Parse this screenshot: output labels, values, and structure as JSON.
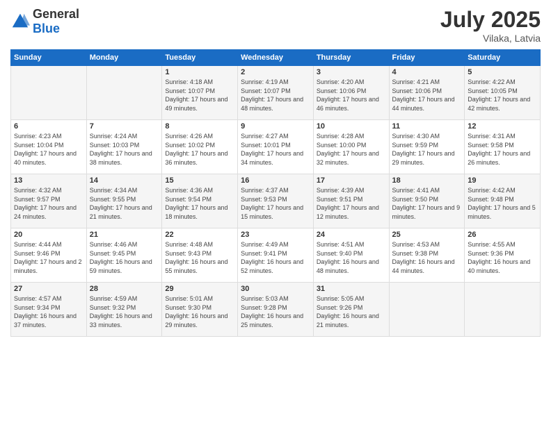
{
  "logo": {
    "general": "General",
    "blue": "Blue"
  },
  "header": {
    "month": "July 2025",
    "location": "Vilaka, Latvia"
  },
  "days_of_week": [
    "Sunday",
    "Monday",
    "Tuesday",
    "Wednesday",
    "Thursday",
    "Friday",
    "Saturday"
  ],
  "weeks": [
    [
      {
        "day": "",
        "info": ""
      },
      {
        "day": "",
        "info": ""
      },
      {
        "day": "1",
        "info": "Sunrise: 4:18 AM\nSunset: 10:07 PM\nDaylight: 17 hours and 49 minutes."
      },
      {
        "day": "2",
        "info": "Sunrise: 4:19 AM\nSunset: 10:07 PM\nDaylight: 17 hours and 48 minutes."
      },
      {
        "day": "3",
        "info": "Sunrise: 4:20 AM\nSunset: 10:06 PM\nDaylight: 17 hours and 46 minutes."
      },
      {
        "day": "4",
        "info": "Sunrise: 4:21 AM\nSunset: 10:06 PM\nDaylight: 17 hours and 44 minutes."
      },
      {
        "day": "5",
        "info": "Sunrise: 4:22 AM\nSunset: 10:05 PM\nDaylight: 17 hours and 42 minutes."
      }
    ],
    [
      {
        "day": "6",
        "info": "Sunrise: 4:23 AM\nSunset: 10:04 PM\nDaylight: 17 hours and 40 minutes."
      },
      {
        "day": "7",
        "info": "Sunrise: 4:24 AM\nSunset: 10:03 PM\nDaylight: 17 hours and 38 minutes."
      },
      {
        "day": "8",
        "info": "Sunrise: 4:26 AM\nSunset: 10:02 PM\nDaylight: 17 hours and 36 minutes."
      },
      {
        "day": "9",
        "info": "Sunrise: 4:27 AM\nSunset: 10:01 PM\nDaylight: 17 hours and 34 minutes."
      },
      {
        "day": "10",
        "info": "Sunrise: 4:28 AM\nSunset: 10:00 PM\nDaylight: 17 hours and 32 minutes."
      },
      {
        "day": "11",
        "info": "Sunrise: 4:30 AM\nSunset: 9:59 PM\nDaylight: 17 hours and 29 minutes."
      },
      {
        "day": "12",
        "info": "Sunrise: 4:31 AM\nSunset: 9:58 PM\nDaylight: 17 hours and 26 minutes."
      }
    ],
    [
      {
        "day": "13",
        "info": "Sunrise: 4:32 AM\nSunset: 9:57 PM\nDaylight: 17 hours and 24 minutes."
      },
      {
        "day": "14",
        "info": "Sunrise: 4:34 AM\nSunset: 9:55 PM\nDaylight: 17 hours and 21 minutes."
      },
      {
        "day": "15",
        "info": "Sunrise: 4:36 AM\nSunset: 9:54 PM\nDaylight: 17 hours and 18 minutes."
      },
      {
        "day": "16",
        "info": "Sunrise: 4:37 AM\nSunset: 9:53 PM\nDaylight: 17 hours and 15 minutes."
      },
      {
        "day": "17",
        "info": "Sunrise: 4:39 AM\nSunset: 9:51 PM\nDaylight: 17 hours and 12 minutes."
      },
      {
        "day": "18",
        "info": "Sunrise: 4:41 AM\nSunset: 9:50 PM\nDaylight: 17 hours and 9 minutes."
      },
      {
        "day": "19",
        "info": "Sunrise: 4:42 AM\nSunset: 9:48 PM\nDaylight: 17 hours and 5 minutes."
      }
    ],
    [
      {
        "day": "20",
        "info": "Sunrise: 4:44 AM\nSunset: 9:46 PM\nDaylight: 17 hours and 2 minutes."
      },
      {
        "day": "21",
        "info": "Sunrise: 4:46 AM\nSunset: 9:45 PM\nDaylight: 16 hours and 59 minutes."
      },
      {
        "day": "22",
        "info": "Sunrise: 4:48 AM\nSunset: 9:43 PM\nDaylight: 16 hours and 55 minutes."
      },
      {
        "day": "23",
        "info": "Sunrise: 4:49 AM\nSunset: 9:41 PM\nDaylight: 16 hours and 52 minutes."
      },
      {
        "day": "24",
        "info": "Sunrise: 4:51 AM\nSunset: 9:40 PM\nDaylight: 16 hours and 48 minutes."
      },
      {
        "day": "25",
        "info": "Sunrise: 4:53 AM\nSunset: 9:38 PM\nDaylight: 16 hours and 44 minutes."
      },
      {
        "day": "26",
        "info": "Sunrise: 4:55 AM\nSunset: 9:36 PM\nDaylight: 16 hours and 40 minutes."
      }
    ],
    [
      {
        "day": "27",
        "info": "Sunrise: 4:57 AM\nSunset: 9:34 PM\nDaylight: 16 hours and 37 minutes."
      },
      {
        "day": "28",
        "info": "Sunrise: 4:59 AM\nSunset: 9:32 PM\nDaylight: 16 hours and 33 minutes."
      },
      {
        "day": "29",
        "info": "Sunrise: 5:01 AM\nSunset: 9:30 PM\nDaylight: 16 hours and 29 minutes."
      },
      {
        "day": "30",
        "info": "Sunrise: 5:03 AM\nSunset: 9:28 PM\nDaylight: 16 hours and 25 minutes."
      },
      {
        "day": "31",
        "info": "Sunrise: 5:05 AM\nSunset: 9:26 PM\nDaylight: 16 hours and 21 minutes."
      },
      {
        "day": "",
        "info": ""
      },
      {
        "day": "",
        "info": ""
      }
    ]
  ]
}
